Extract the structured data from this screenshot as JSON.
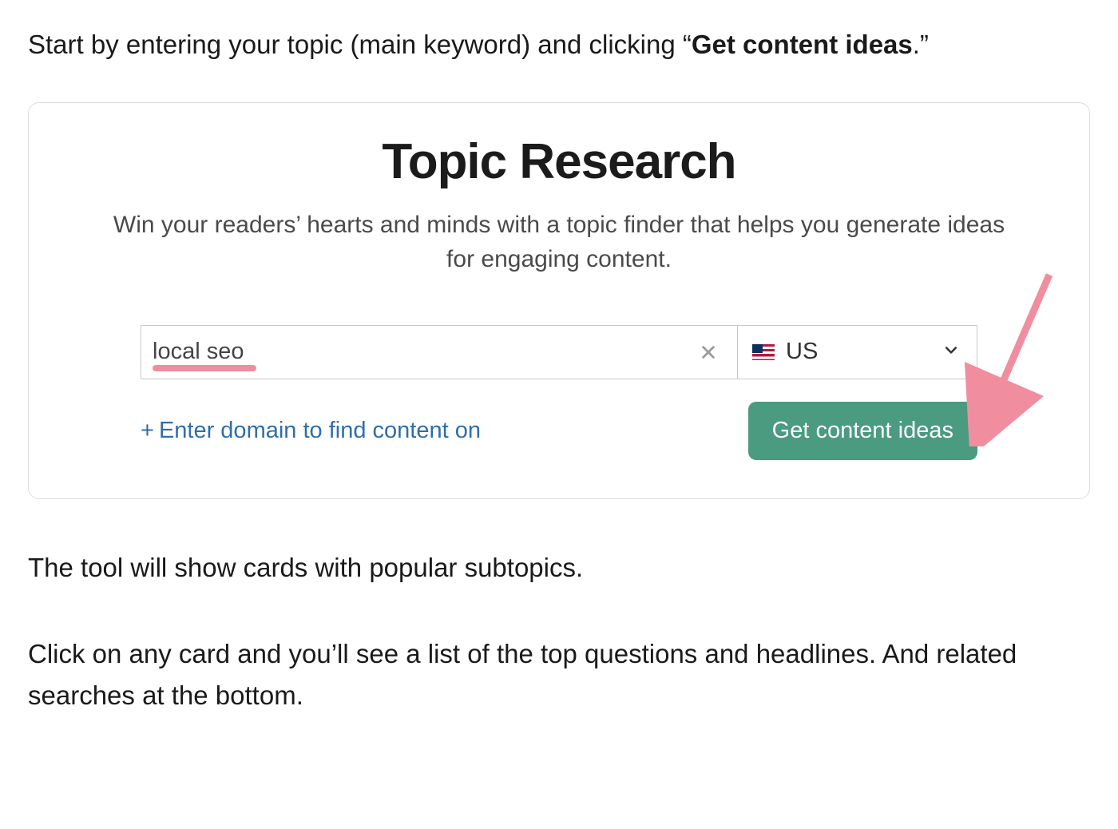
{
  "intro": {
    "part1": "Start by entering your topic (main keyword) and clicking “",
    "bold": "Get content ideas",
    "part2": ".”"
  },
  "card": {
    "title": "Topic Research",
    "subtitle": "Win your readers’ hearts and minds with a topic finder that helps you generate ideas for engaging content.",
    "topic_value": "local seo",
    "country": "US",
    "domain_link": "Enter domain to find content on",
    "cta_label": "Get content ideas"
  },
  "outro": {
    "p1": "The tool will show cards with popular subtopics.",
    "p2": "Click on any card and you’ll see a list of the top questions and headlines. And related searches at the bottom."
  },
  "colors": {
    "accent_pink": "#f08ea0",
    "button_green": "#4a9b7f",
    "link_blue": "#2f6ea8"
  }
}
